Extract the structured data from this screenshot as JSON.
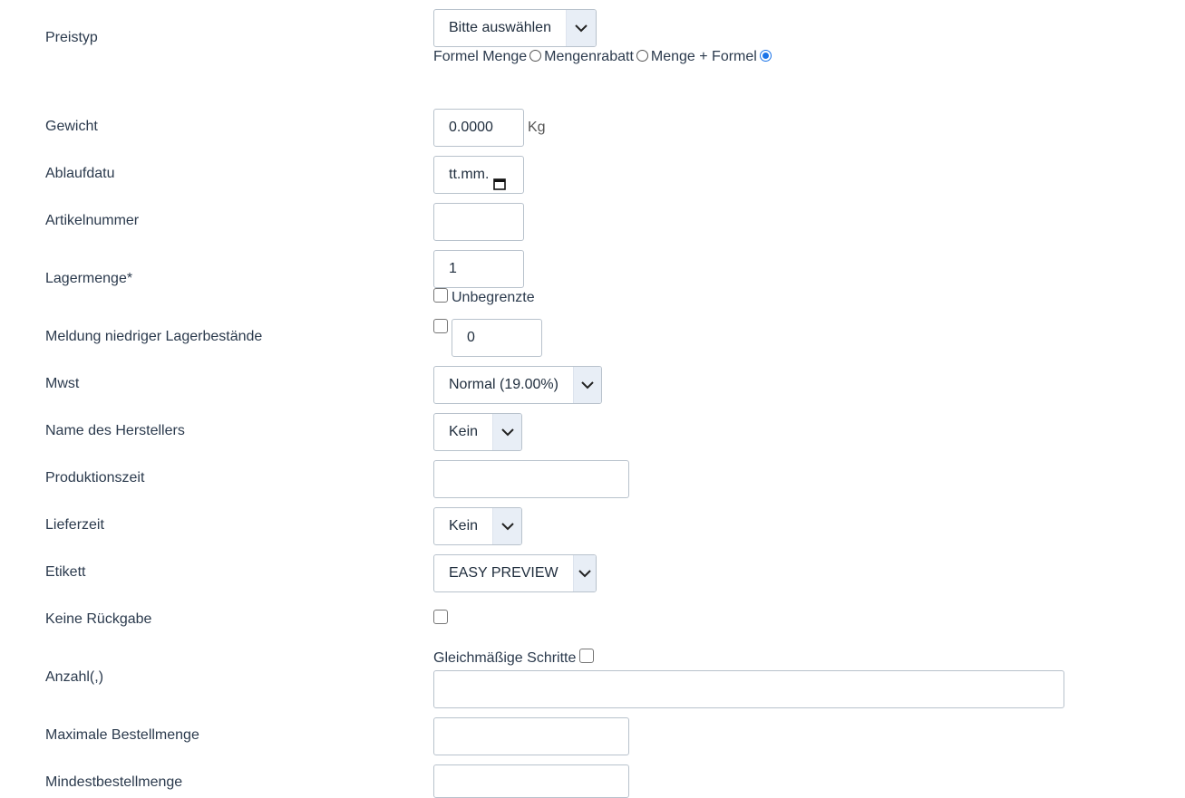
{
  "fields": {
    "preistyp": {
      "label": "Preistyp",
      "select_value": "Bitte auswählen",
      "radios": [
        {
          "label": "Formel Menge",
          "checked": false
        },
        {
          "label": "Mengenrabatt",
          "checked": false
        },
        {
          "label": "Menge + Formel",
          "checked": true
        }
      ]
    },
    "gewicht": {
      "label": "Gewicht",
      "value": "0.0000",
      "unit": "Kg"
    },
    "ablaufdatum": {
      "label": "Ablaufdatu",
      "value": "tt.mm."
    },
    "artikelnummer": {
      "label": "Artikelnummer",
      "value": ""
    },
    "lagermenge": {
      "label": "Lagermenge*",
      "value": "1",
      "checkbox_label": "Unbegrenzte"
    },
    "meldung": {
      "label": "Meldung niedriger Lagerbestände",
      "value": "0"
    },
    "mwst": {
      "label": "Mwst",
      "select_value": "Normal (19.00%)"
    },
    "hersteller": {
      "label": "Name des Herstellers",
      "select_value": "Kein"
    },
    "produktionszeit": {
      "label": "Produktionszeit",
      "value": ""
    },
    "lieferzeit": {
      "label": "Lieferzeit",
      "select_value": "Kein"
    },
    "etikett": {
      "label": "Etikett",
      "select_value": "EASY PREVIEW"
    },
    "keine_rueckgabe": {
      "label": "Keine Rückgabe"
    },
    "anzahl": {
      "label": "Anzahl(,)",
      "checkbox_label": "Gleichmäßige Schritte",
      "value": ""
    },
    "max_bestellmenge": {
      "label": "Maximale Bestellmenge",
      "value": ""
    },
    "min_bestellmenge": {
      "label": "Mindestbestellmenge",
      "value": ""
    }
  },
  "icons": {
    "chevron": "chevron-down-icon",
    "calendar": "calendar-icon"
  },
  "colors": {
    "radio_checked": "#1a73e8",
    "select_button_bg": "#e8eef6",
    "input_border": "#b8c2cc"
  }
}
